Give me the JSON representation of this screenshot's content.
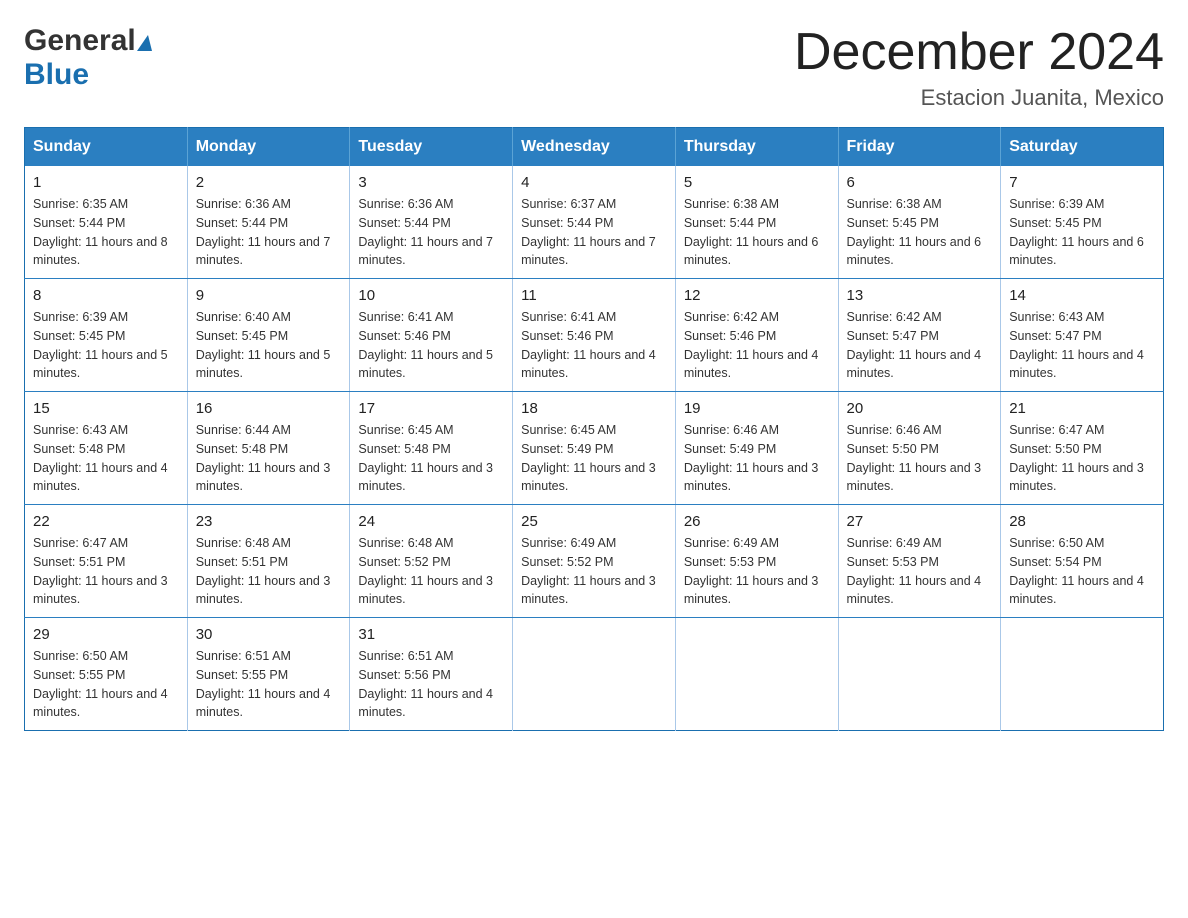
{
  "header": {
    "month_title": "December 2024",
    "subtitle": "Estacion Juanita, Mexico",
    "logo_general": "General",
    "logo_blue": "Blue"
  },
  "days_of_week": [
    "Sunday",
    "Monday",
    "Tuesday",
    "Wednesday",
    "Thursday",
    "Friday",
    "Saturday"
  ],
  "weeks": [
    [
      {
        "day": "1",
        "sunrise": "Sunrise: 6:35 AM",
        "sunset": "Sunset: 5:44 PM",
        "daylight": "Daylight: 11 hours and 8 minutes."
      },
      {
        "day": "2",
        "sunrise": "Sunrise: 6:36 AM",
        "sunset": "Sunset: 5:44 PM",
        "daylight": "Daylight: 11 hours and 7 minutes."
      },
      {
        "day": "3",
        "sunrise": "Sunrise: 6:36 AM",
        "sunset": "Sunset: 5:44 PM",
        "daylight": "Daylight: 11 hours and 7 minutes."
      },
      {
        "day": "4",
        "sunrise": "Sunrise: 6:37 AM",
        "sunset": "Sunset: 5:44 PM",
        "daylight": "Daylight: 11 hours and 7 minutes."
      },
      {
        "day": "5",
        "sunrise": "Sunrise: 6:38 AM",
        "sunset": "Sunset: 5:44 PM",
        "daylight": "Daylight: 11 hours and 6 minutes."
      },
      {
        "day": "6",
        "sunrise": "Sunrise: 6:38 AM",
        "sunset": "Sunset: 5:45 PM",
        "daylight": "Daylight: 11 hours and 6 minutes."
      },
      {
        "day": "7",
        "sunrise": "Sunrise: 6:39 AM",
        "sunset": "Sunset: 5:45 PM",
        "daylight": "Daylight: 11 hours and 6 minutes."
      }
    ],
    [
      {
        "day": "8",
        "sunrise": "Sunrise: 6:39 AM",
        "sunset": "Sunset: 5:45 PM",
        "daylight": "Daylight: 11 hours and 5 minutes."
      },
      {
        "day": "9",
        "sunrise": "Sunrise: 6:40 AM",
        "sunset": "Sunset: 5:45 PM",
        "daylight": "Daylight: 11 hours and 5 minutes."
      },
      {
        "day": "10",
        "sunrise": "Sunrise: 6:41 AM",
        "sunset": "Sunset: 5:46 PM",
        "daylight": "Daylight: 11 hours and 5 minutes."
      },
      {
        "day": "11",
        "sunrise": "Sunrise: 6:41 AM",
        "sunset": "Sunset: 5:46 PM",
        "daylight": "Daylight: 11 hours and 4 minutes."
      },
      {
        "day": "12",
        "sunrise": "Sunrise: 6:42 AM",
        "sunset": "Sunset: 5:46 PM",
        "daylight": "Daylight: 11 hours and 4 minutes."
      },
      {
        "day": "13",
        "sunrise": "Sunrise: 6:42 AM",
        "sunset": "Sunset: 5:47 PM",
        "daylight": "Daylight: 11 hours and 4 minutes."
      },
      {
        "day": "14",
        "sunrise": "Sunrise: 6:43 AM",
        "sunset": "Sunset: 5:47 PM",
        "daylight": "Daylight: 11 hours and 4 minutes."
      }
    ],
    [
      {
        "day": "15",
        "sunrise": "Sunrise: 6:43 AM",
        "sunset": "Sunset: 5:48 PM",
        "daylight": "Daylight: 11 hours and 4 minutes."
      },
      {
        "day": "16",
        "sunrise": "Sunrise: 6:44 AM",
        "sunset": "Sunset: 5:48 PM",
        "daylight": "Daylight: 11 hours and 3 minutes."
      },
      {
        "day": "17",
        "sunrise": "Sunrise: 6:45 AM",
        "sunset": "Sunset: 5:48 PM",
        "daylight": "Daylight: 11 hours and 3 minutes."
      },
      {
        "day": "18",
        "sunrise": "Sunrise: 6:45 AM",
        "sunset": "Sunset: 5:49 PM",
        "daylight": "Daylight: 11 hours and 3 minutes."
      },
      {
        "day": "19",
        "sunrise": "Sunrise: 6:46 AM",
        "sunset": "Sunset: 5:49 PM",
        "daylight": "Daylight: 11 hours and 3 minutes."
      },
      {
        "day": "20",
        "sunrise": "Sunrise: 6:46 AM",
        "sunset": "Sunset: 5:50 PM",
        "daylight": "Daylight: 11 hours and 3 minutes."
      },
      {
        "day": "21",
        "sunrise": "Sunrise: 6:47 AM",
        "sunset": "Sunset: 5:50 PM",
        "daylight": "Daylight: 11 hours and 3 minutes."
      }
    ],
    [
      {
        "day": "22",
        "sunrise": "Sunrise: 6:47 AM",
        "sunset": "Sunset: 5:51 PM",
        "daylight": "Daylight: 11 hours and 3 minutes."
      },
      {
        "day": "23",
        "sunrise": "Sunrise: 6:48 AM",
        "sunset": "Sunset: 5:51 PM",
        "daylight": "Daylight: 11 hours and 3 minutes."
      },
      {
        "day": "24",
        "sunrise": "Sunrise: 6:48 AM",
        "sunset": "Sunset: 5:52 PM",
        "daylight": "Daylight: 11 hours and 3 minutes."
      },
      {
        "day": "25",
        "sunrise": "Sunrise: 6:49 AM",
        "sunset": "Sunset: 5:52 PM",
        "daylight": "Daylight: 11 hours and 3 minutes."
      },
      {
        "day": "26",
        "sunrise": "Sunrise: 6:49 AM",
        "sunset": "Sunset: 5:53 PM",
        "daylight": "Daylight: 11 hours and 3 minutes."
      },
      {
        "day": "27",
        "sunrise": "Sunrise: 6:49 AM",
        "sunset": "Sunset: 5:53 PM",
        "daylight": "Daylight: 11 hours and 4 minutes."
      },
      {
        "day": "28",
        "sunrise": "Sunrise: 6:50 AM",
        "sunset": "Sunset: 5:54 PM",
        "daylight": "Daylight: 11 hours and 4 minutes."
      }
    ],
    [
      {
        "day": "29",
        "sunrise": "Sunrise: 6:50 AM",
        "sunset": "Sunset: 5:55 PM",
        "daylight": "Daylight: 11 hours and 4 minutes."
      },
      {
        "day": "30",
        "sunrise": "Sunrise: 6:51 AM",
        "sunset": "Sunset: 5:55 PM",
        "daylight": "Daylight: 11 hours and 4 minutes."
      },
      {
        "day": "31",
        "sunrise": "Sunrise: 6:51 AM",
        "sunset": "Sunset: 5:56 PM",
        "daylight": "Daylight: 11 hours and 4 minutes."
      },
      null,
      null,
      null,
      null
    ]
  ]
}
